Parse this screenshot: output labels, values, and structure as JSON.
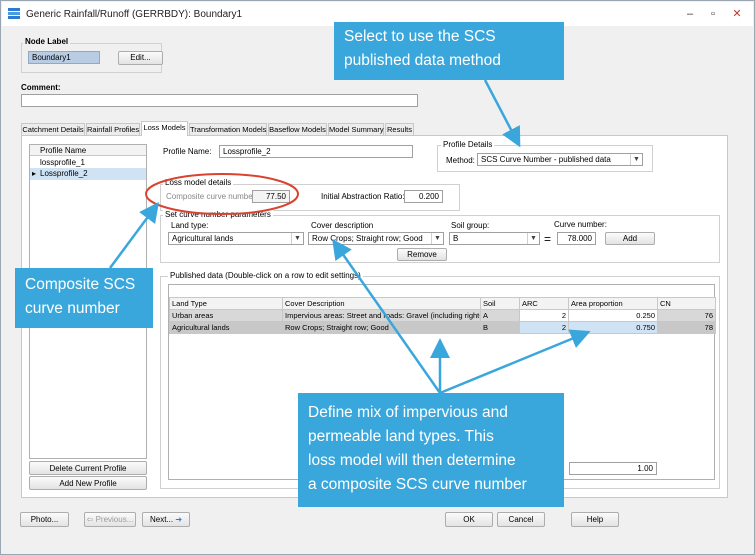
{
  "window": {
    "title": "Generic Rainfall/Runoff (GERRBDY): Boundary1",
    "min_glyph": "–",
    "max_glyph": "▫",
    "close_glyph": "✕"
  },
  "node": {
    "group_label": "Node Label",
    "value": "Boundary1",
    "edit_label": "Edit..."
  },
  "comment": {
    "label": "Comment:",
    "value": ""
  },
  "tabs": [
    "Catchment Details",
    "Rainfall Profiles",
    "Loss Models",
    "Transformation Models",
    "Baseflow Models",
    "Model Summary",
    "Results"
  ],
  "profiles": {
    "header": "Profile Name",
    "items": [
      {
        "name": "lossprofile_1",
        "marker": ""
      },
      {
        "name": "Lossprofile_2",
        "marker": "▸"
      }
    ],
    "delete_label": "Delete Current Profile",
    "add_label": "Add New Profile"
  },
  "profile_name": {
    "label": "Profile Name:",
    "value": "Lossprofile_2"
  },
  "profile_details": {
    "group_label": "Profile Details",
    "method_label": "Method:",
    "method_value": "SCS Curve Number - published data"
  },
  "loss_model": {
    "group_label": "Loss model details",
    "composite_label": "Composite curve number:",
    "composite_value": "77.50",
    "ia_label": "Initial Abstraction Ratio:",
    "ia_value": "0.200"
  },
  "curve_params": {
    "group_label": "Set curve number parameters",
    "land_type_label": "Land type:",
    "land_type_value": "Agricultural lands",
    "cover_label": "Cover description",
    "cover_value": "Row Crops; Straight row; Good",
    "soil_label": "Soil group:",
    "soil_value": "B",
    "equals": "=",
    "cn_label": "Curve number:",
    "cn_value": "78.000",
    "add_label": "Add",
    "remove_label": "Remove"
  },
  "published": {
    "group_label": "Published data (Double-click on a row to edit settings)",
    "columns": [
      "Land Type",
      "Cover Description",
      "Soil",
      "ARC",
      "Area proportion",
      "CN"
    ],
    "rows": [
      [
        "Urban areas",
        "Impervious areas: Street and roads: Gravel (including right-of-",
        "A",
        "2",
        "0.250",
        "76"
      ],
      [
        "Agricultural lands",
        "Row Crops; Straight row; Good",
        "B",
        "2",
        "0.750",
        "78"
      ]
    ],
    "total": "1.00"
  },
  "bottom_buttons": {
    "photo": "Photo...",
    "previous": "Previous...",
    "next": "Next...",
    "ok": "OK",
    "cancel": "Cancel",
    "help": "Help"
  },
  "callouts": {
    "method_line1": "Select to use the SCS",
    "method_line2": "published data method",
    "composite_line1": "Composite SCS",
    "composite_line2": "curve number",
    "mix_line1": "Define mix of impervious and",
    "mix_line2": "permeable land types. This",
    "mix_line3": "loss model will then determine",
    "mix_line4": "a composite SCS curve number"
  },
  "colors": {
    "callout": "#3aa7dc",
    "highlight_ring": "#d9432f",
    "selected_row": "#cfe3f5"
  },
  "icons": {
    "app": "app-icon",
    "next_arrow": "arrow-right-icon",
    "previous_arrow": "arrow-left-icon",
    "dropdown": "chevron-down-icon"
  }
}
